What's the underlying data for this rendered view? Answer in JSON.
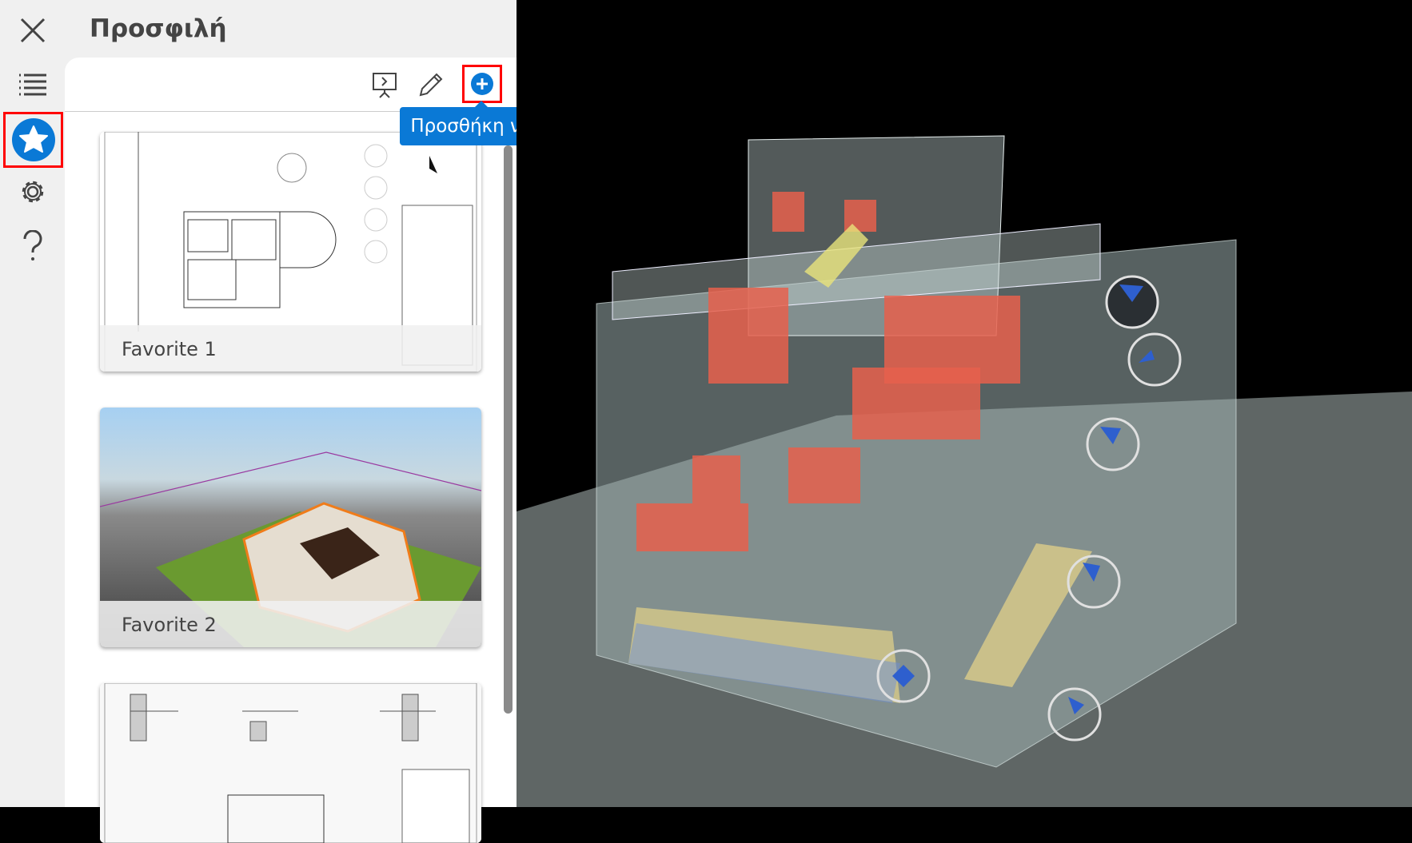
{
  "panel": {
    "title": "Προσφιλή"
  },
  "rail": {
    "items": [
      {
        "icon": "close-icon"
      },
      {
        "icon": "list-icon"
      },
      {
        "icon": "star-icon",
        "active": true
      },
      {
        "icon": "gear-icon"
      },
      {
        "icon": "help-icon"
      }
    ]
  },
  "toolbar": {
    "present_icon": "presentation-icon",
    "edit_icon": "pencil-icon",
    "add_icon": "plus-circle-icon",
    "add_tooltip": "Προσθήκη νέου"
  },
  "favorites": [
    {
      "label": "Favorite 1"
    },
    {
      "label": "Favorite 2"
    },
    {
      "label": ""
    }
  ],
  "colors": {
    "accent": "#0a79d6",
    "highlight": "#ff0000"
  }
}
